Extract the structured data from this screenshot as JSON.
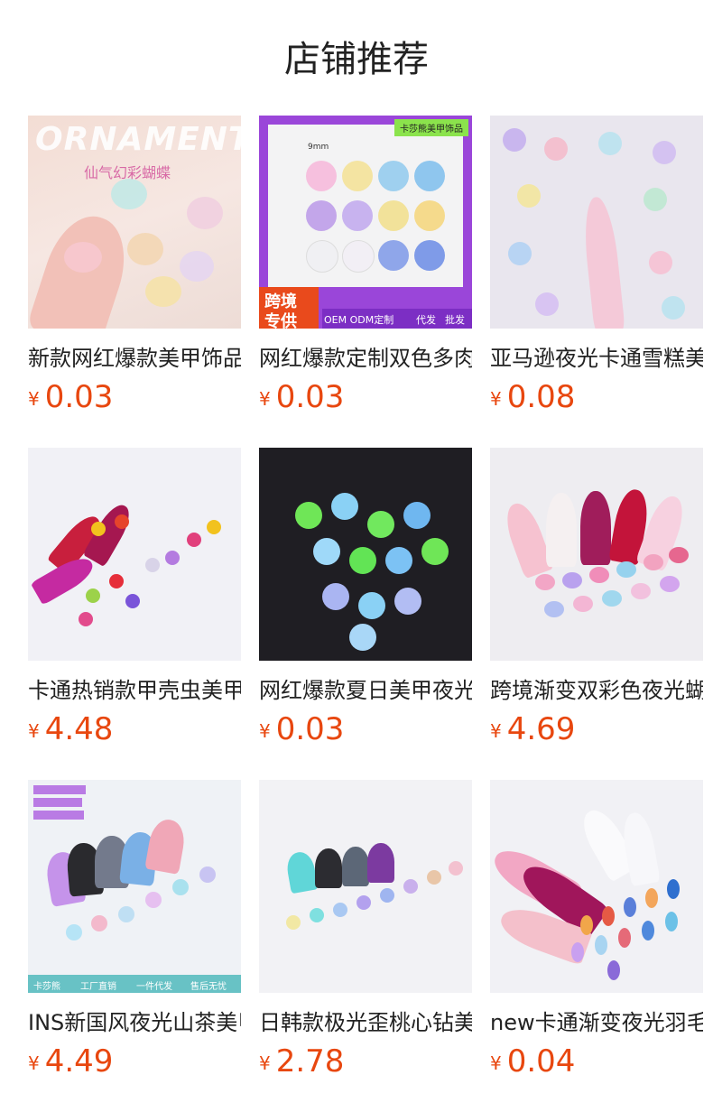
{
  "header": {
    "title": "店铺推荐"
  },
  "currency": "¥",
  "products": [
    {
      "name": "新款网红爆款美甲饰品",
      "price": "0.03",
      "image": "butterfly-ornaments",
      "overlay": [
        "ORNAMENTS",
        "仙气幻彩蝴蝶"
      ]
    },
    {
      "name": "网红爆款定制双色多肉花",
      "price": "0.03",
      "image": "two-tone-flowers",
      "overlay": [
        "卡莎熊美甲饰品",
        "9mm",
        "跨境",
        "专供",
        "OEM ODM定制",
        "代发",
        "批发"
      ]
    },
    {
      "name": "亚马逊夜光卡通雪糕美甲",
      "price": "0.08",
      "image": "cartoon-charms"
    },
    {
      "name": "卡通热销款甲壳虫美甲",
      "price": "4.48",
      "image": "ladybug-charms"
    },
    {
      "name": "网红爆款夏日美甲夜光花",
      "price": "0.03",
      "image": "glow-roses"
    },
    {
      "name": "跨境渐变双彩色夜光蝴蝶",
      "price": "4.69",
      "image": "gradient-butterflies"
    },
    {
      "name": "INS新国风夜光山茶美甲",
      "price": "4.49",
      "image": "camellia-charms",
      "overlay": [
        "卡莎熊",
        "工厂直销",
        "一件代发",
        "售后无忧"
      ]
    },
    {
      "name": "日韩款极光歪桃心钻美甲",
      "price": "2.78",
      "image": "aurora-hearts"
    },
    {
      "name": "new卡通渐变夜光羽毛美甲",
      "price": "0.04",
      "image": "gradient-feathers"
    }
  ],
  "colors": {
    "price": "#e8470f",
    "title": "#222222"
  }
}
